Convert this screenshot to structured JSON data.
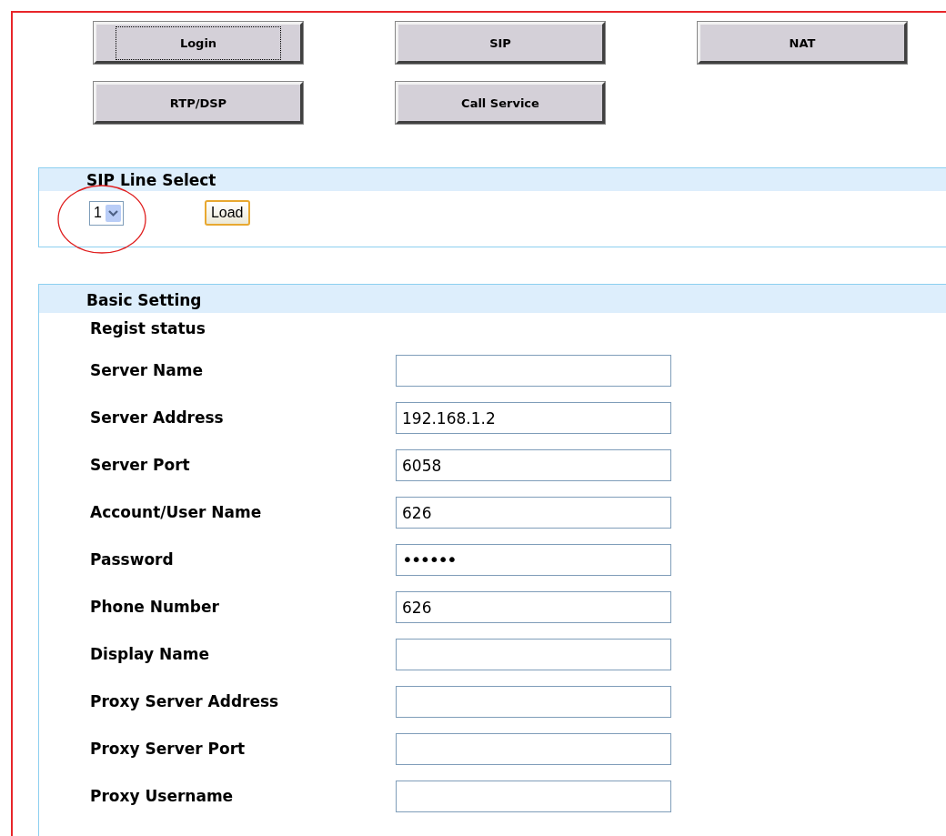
{
  "nav_buttons": [
    {
      "label": "Login",
      "focused": true
    },
    {
      "label": "SIP",
      "focused": false
    },
    {
      "label": "NAT",
      "focused": false
    },
    {
      "label": "RTP/DSP",
      "focused": false
    },
    {
      "label": "Call Service",
      "focused": false
    }
  ],
  "line_select": {
    "title": "SIP Line Select",
    "value": "1",
    "load_button": "Load",
    "highlighted": true
  },
  "basic_setting": {
    "title": "Basic Setting",
    "fields": [
      {
        "label": "Regist status",
        "kind": "status"
      },
      {
        "label": "Server Name",
        "kind": "input"
      },
      {
        "label": "Server Address",
        "kind": "input",
        "value": "192.168.1.2"
      },
      {
        "label": "Server Port",
        "kind": "input",
        "value": "6058"
      },
      {
        "label": "Account/User Name",
        "kind": "input",
        "value": "626"
      },
      {
        "label": "Password",
        "kind": "password",
        "value": "••••••"
      },
      {
        "label": "Phone Number",
        "kind": "input",
        "value": "626"
      },
      {
        "label": "Display Name",
        "kind": "input"
      },
      {
        "label": "Proxy Server Address",
        "kind": "input"
      },
      {
        "label": "Proxy Server Port",
        "kind": "input"
      },
      {
        "label": "Proxy Username",
        "kind": "input"
      }
    ]
  }
}
